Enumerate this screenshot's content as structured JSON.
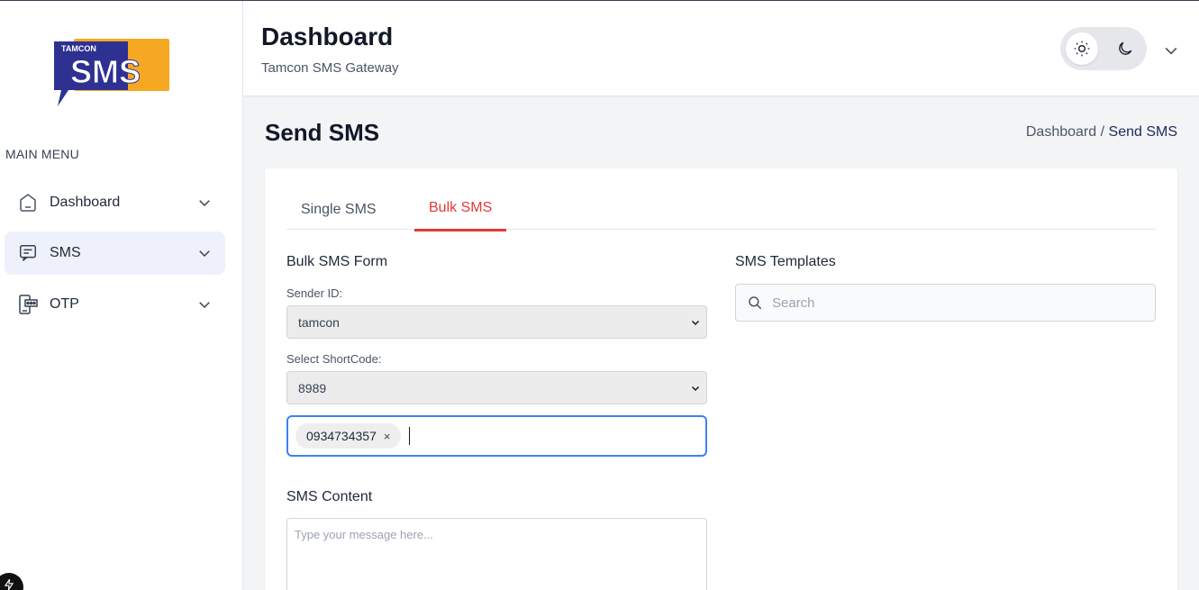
{
  "brand": {
    "logo_top": "TAMCON",
    "logo_main": "SMS",
    "colors": {
      "logo_blue": "#2e3192",
      "logo_orange": "#f7a823"
    }
  },
  "sidebar": {
    "menu_title": "MAIN MENU",
    "items": [
      {
        "label": "Dashboard",
        "icon": "home-icon"
      },
      {
        "label": "SMS",
        "icon": "message-icon"
      },
      {
        "label": "OTP",
        "icon": "otp-device-icon"
      }
    ]
  },
  "header": {
    "title": "Dashboard",
    "subtitle": "Tamcon SMS Gateway",
    "theme": "light"
  },
  "page": {
    "title": "Send SMS",
    "breadcrumb": {
      "parent": "Dashboard",
      "separator": "/",
      "current": "Send SMS"
    }
  },
  "tabs": [
    {
      "label": "Single SMS",
      "active": false
    },
    {
      "label": "Bulk SMS",
      "active": true
    }
  ],
  "form": {
    "title": "Bulk SMS Form",
    "sender_label": "Sender ID:",
    "sender_value": "tamcon",
    "shortcode_label": "Select ShortCode:",
    "shortcode_value": "8989",
    "recipient_tags": [
      "0934734357"
    ],
    "tag_remove": "×",
    "content_label": "SMS Content",
    "content_placeholder": "Type your message here..."
  },
  "templates": {
    "title": "SMS Templates",
    "search_placeholder": "Search"
  },
  "colors": {
    "accent_red": "#e53935",
    "focus_blue": "#3b82f6",
    "active_nav_bg": "#eef0fb"
  }
}
